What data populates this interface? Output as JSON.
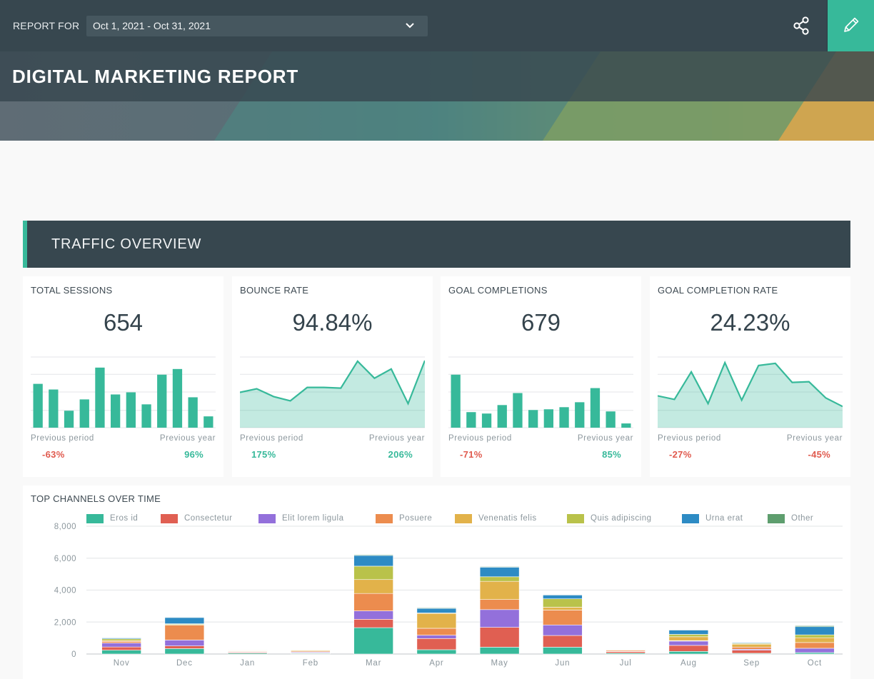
{
  "header": {
    "report_for_label": "REPORT FOR",
    "date_range": "Oct 1, 2021 - Oct 31, 2021",
    "title": "DIGITAL MARKETING REPORT",
    "share_icon": "share-icon",
    "edit_icon": "pencil-icon",
    "accent_color": "#37b99a"
  },
  "section": {
    "title": "TRAFFIC OVERVIEW"
  },
  "kpis": [
    {
      "label": "TOTAL SESSIONS",
      "value": "654",
      "chart_type": "bar",
      "series": [
        62,
        54,
        24,
        40,
        85,
        47,
        50,
        33,
        75,
        83,
        43,
        16
      ],
      "prev_period_label": "Previous period",
      "prev_period_value": "-63%",
      "prev_period_trend": "down",
      "prev_year_label": "Previous year",
      "prev_year_value": "96%",
      "prev_year_trend": "up"
    },
    {
      "label": "BOUNCE RATE",
      "value": "94.84%",
      "chart_type": "area",
      "series": [
        50,
        55,
        44,
        38,
        57,
        57,
        56,
        94,
        70,
        83,
        34,
        95
      ],
      "prev_period_label": "Previous period",
      "prev_period_value": "175%",
      "prev_period_trend": "up",
      "prev_year_label": "Previous year",
      "prev_year_value": "206%",
      "prev_year_trend": "up"
    },
    {
      "label": "GOAL COMPLETIONS",
      "value": "679",
      "chart_type": "bar",
      "series": [
        75,
        22,
        20,
        32,
        49,
        25,
        26,
        29,
        36,
        56,
        23,
        6
      ],
      "prev_period_label": "Previous period",
      "prev_period_value": "-71%",
      "prev_period_trend": "down",
      "prev_year_label": "Previous year",
      "prev_year_value": "85%",
      "prev_year_trend": "up"
    },
    {
      "label": "GOAL COMPLETION RATE",
      "value": "24.23%",
      "chart_type": "area",
      "series": [
        45,
        40,
        79,
        34,
        92,
        39,
        88,
        91,
        64,
        65,
        42,
        30
      ],
      "prev_period_label": "Previous period",
      "prev_period_value": "-27%",
      "prev_period_trend": "down",
      "prev_year_label": "Previous year",
      "prev_year_value": "-45%",
      "prev_year_trend": "down"
    }
  ],
  "trend_colors": {
    "up": "#37b99a",
    "down": "#e05a4e"
  },
  "chart_data": {
    "type": "bar",
    "stacked": true,
    "title": "TOP CHANNELS OVER TIME",
    "xlabel": "",
    "ylabel": "",
    "ylim": [
      0,
      8000
    ],
    "yticks": [
      0,
      2000,
      4000,
      6000,
      8000
    ],
    "ytick_labels": [
      "0",
      "2,000",
      "4,000",
      "6,000",
      "8,000"
    ],
    "grid": true,
    "legend_position": "top",
    "categories": [
      "Nov",
      "Dec",
      "Jan",
      "Feb",
      "Mar",
      "Apr",
      "May",
      "Jun",
      "Jul",
      "Aug",
      "Sep",
      "Oct"
    ],
    "series": [
      {
        "name": "Eros id",
        "color": "#37b99a",
        "values": [
          240,
          340,
          60,
          40,
          1650,
          270,
          430,
          430,
          60,
          165,
          45,
          90
        ]
      },
      {
        "name": "Consectetur",
        "color": "#e05f52",
        "values": [
          200,
          165,
          50,
          30,
          525,
          700,
          1240,
          730,
          90,
          375,
          195,
          0
        ]
      },
      {
        "name": "Elit lorem ligula",
        "color": "#9370db",
        "values": [
          250,
          370,
          30,
          50,
          525,
          210,
          1110,
          660,
          20,
          270,
          60,
          270
        ]
      },
      {
        "name": "Posuere",
        "color": "#ec8c4e",
        "values": [
          100,
          930,
          40,
          50,
          1090,
          430,
          630,
          930,
          60,
          30,
          135,
          360
        ]
      },
      {
        "name": "Venenatis felis",
        "color": "#e2b24a",
        "values": [
          60,
          45,
          30,
          50,
          870,
          930,
          1140,
          180,
          40,
          240,
          180,
          300
        ]
      },
      {
        "name": "Quis adipiscing",
        "color": "#b9c24a",
        "values": [
          100,
          45,
          30,
          20,
          840,
          30,
          285,
          525,
          20,
          150,
          45,
          180
        ]
      },
      {
        "name": "Urna erat",
        "color": "#2d8bc4",
        "values": [
          60,
          390,
          10,
          10,
          670,
          285,
          600,
          240,
          10,
          270,
          45,
          510
        ]
      },
      {
        "name": "Other",
        "color": "#5e9e6e",
        "values": [
          20,
          30,
          20,
          20,
          45,
          40,
          40,
          30,
          20,
          30,
          20,
          60
        ]
      }
    ]
  }
}
